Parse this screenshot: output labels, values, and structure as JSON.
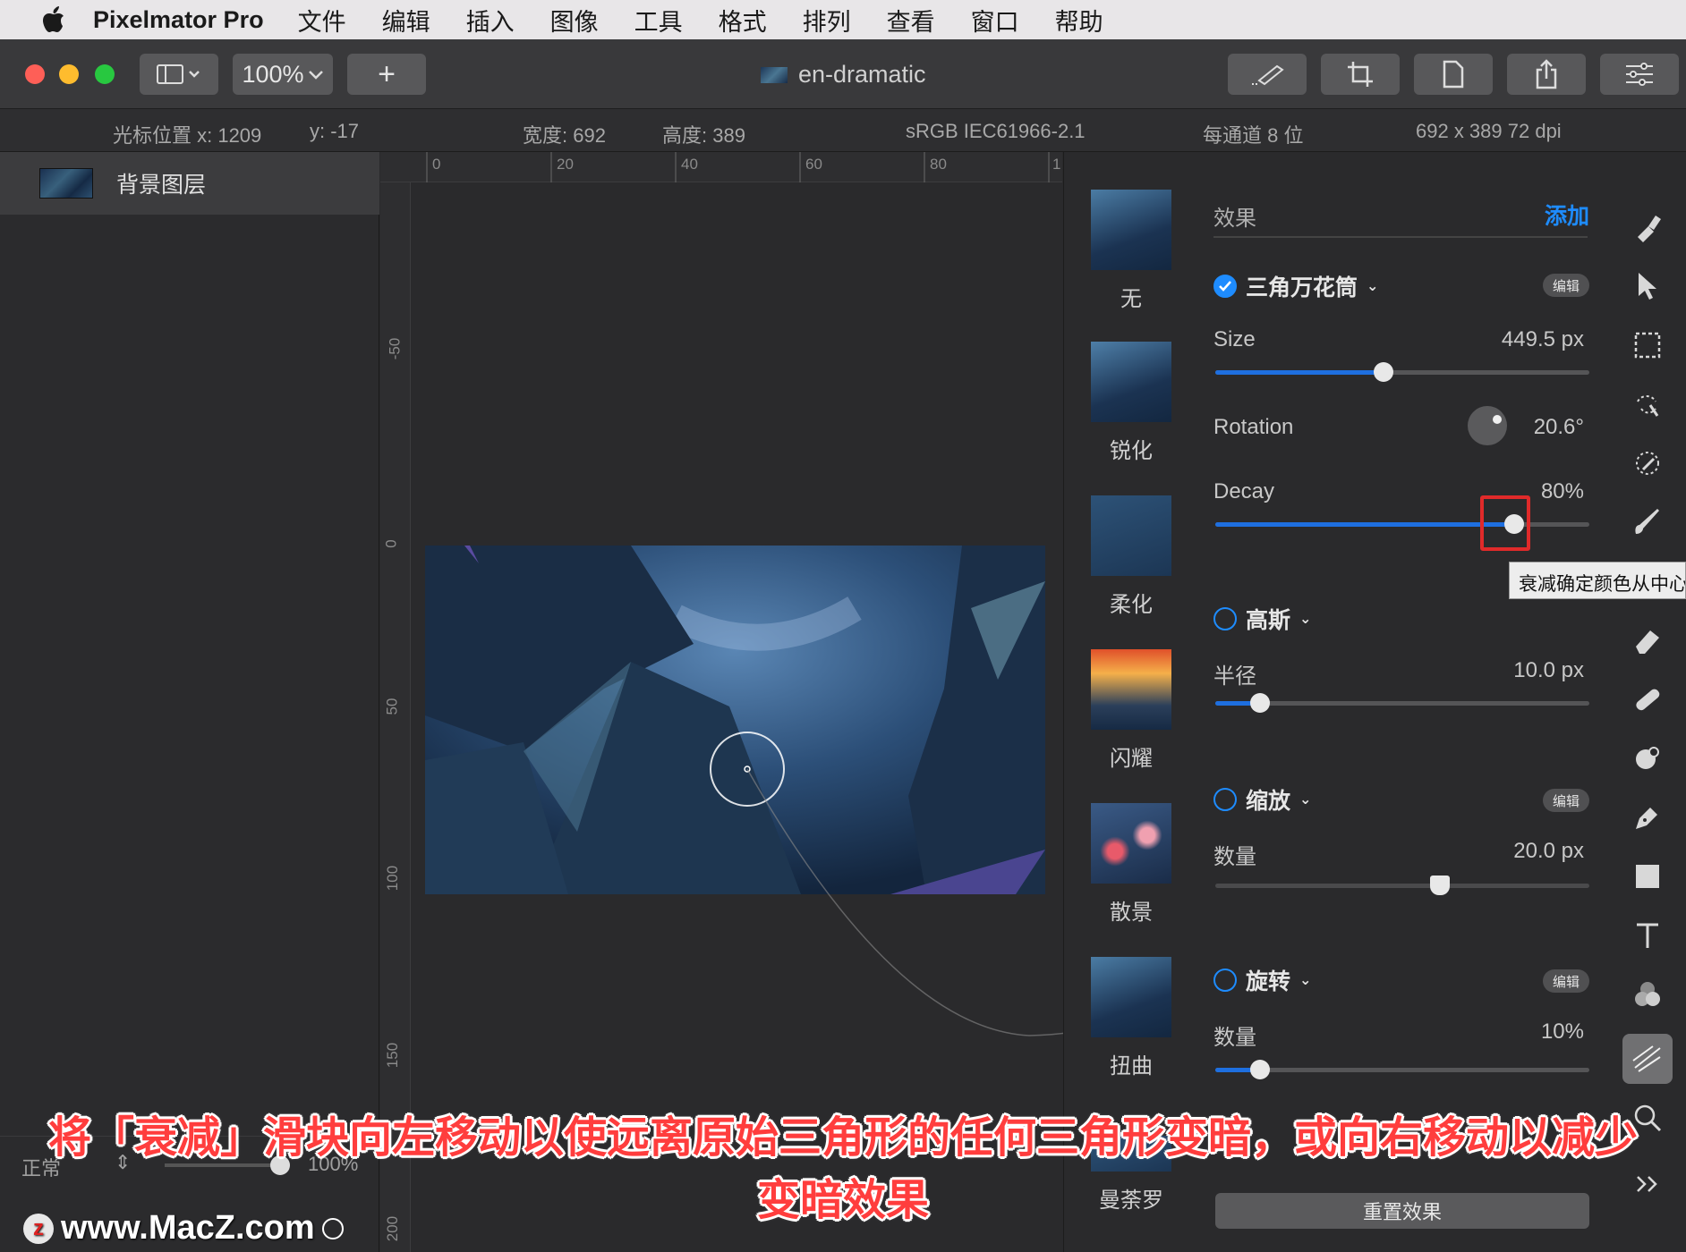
{
  "menubar": {
    "app_name": "Pixelmator Pro",
    "items": [
      "文件",
      "编辑",
      "插入",
      "图像",
      "工具",
      "格式",
      "排列",
      "查看",
      "窗口",
      "帮助"
    ]
  },
  "toolbar": {
    "zoom": "100%",
    "add_label": "+",
    "document_title": "en-dramatic"
  },
  "infobar": {
    "cursor_x_label": "光标位置 x: 1209",
    "cursor_y_label": "y: -17",
    "width_label": "宽度: 692",
    "height_label": "高度: 389",
    "color_profile": "sRGB IEC61966-2.1",
    "bit_depth": "每通道 8 位",
    "dimensions": "692 x 389 72 dpi"
  },
  "layers": {
    "items": [
      {
        "name": "背景图层"
      }
    ],
    "blend_mode": "正常",
    "opacity": "100%"
  },
  "rulers": {
    "top": [
      "0",
      "20",
      "40",
      "60",
      "80",
      "1"
    ],
    "left": [
      "-50",
      "0",
      "50",
      "100",
      "150",
      "200"
    ]
  },
  "effects_browser": {
    "items": [
      "无",
      "锐化",
      "柔化",
      "闪耀",
      "散景",
      "扭曲",
      "曼荼罗"
    ]
  },
  "effects_panel": {
    "title": "效果",
    "add_label": "添加",
    "edit_label": "编辑",
    "groups": [
      {
        "name": "三角万花筒",
        "enabled": true,
        "params": [
          {
            "label": "Size",
            "value": "449.5 px",
            "level": 0.45
          },
          {
            "label": "Rotation",
            "value": "20.6°"
          },
          {
            "label": "Decay",
            "value": "80%",
            "level": 0.8
          }
        ]
      },
      {
        "name": "高斯",
        "enabled": false,
        "params": [
          {
            "label": "半径",
            "value": "10.0 px",
            "level": 0.12
          }
        ]
      },
      {
        "name": "缩放",
        "enabled": false,
        "params": [
          {
            "label": "数量",
            "value": "20.0 px",
            "level": 0.6
          }
        ]
      },
      {
        "name": "旋转",
        "enabled": false,
        "params": [
          {
            "label": "数量",
            "value": "10%",
            "level": 0.12
          }
        ]
      }
    ],
    "reset_label": "重置效果"
  },
  "tooltip": {
    "text": "衰减确定颜色从中心"
  },
  "caption": {
    "line1": "将「衰减」滑块向左移动以使远离原始三角形的任何三角形变暗，或向右移动以减少",
    "line2": "变暗效果"
  },
  "watermark": {
    "text": "www.MacZ.com"
  },
  "colors": {
    "accent": "#1e8cff",
    "highlight": "#e02a2a",
    "caption": "#ff3d3d"
  }
}
